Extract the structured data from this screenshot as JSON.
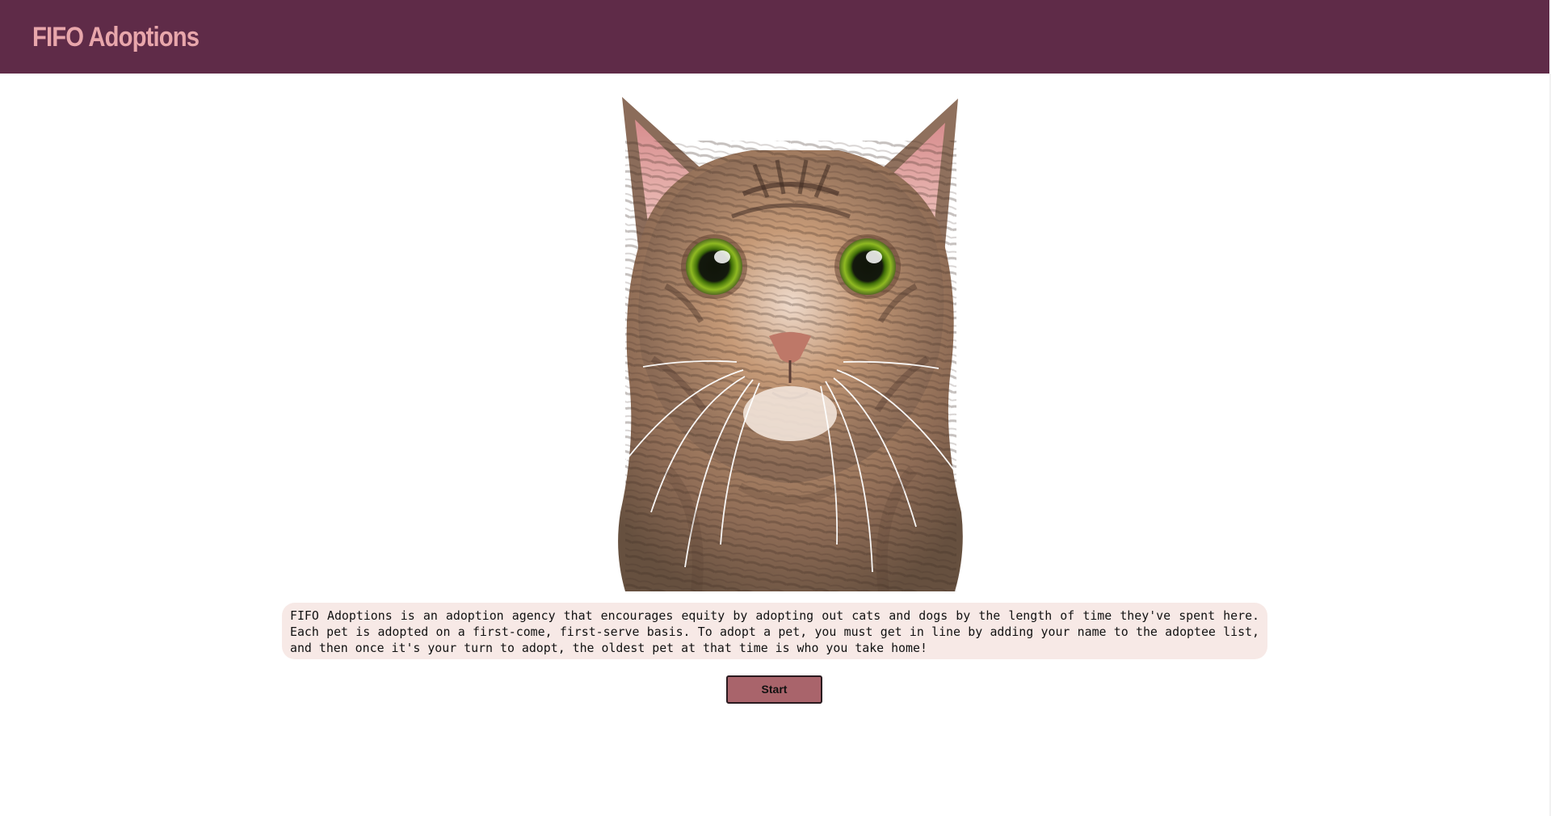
{
  "header": {
    "brand_title": "FIFO Adoptions"
  },
  "hero": {
    "image_icon": "cat-photo",
    "alt": "Tabby cat"
  },
  "intro": {
    "text": "FIFO Adoptions is an adoption agency that encourages equity by adopting out cats and dogs by the length of time they've spent here. Each pet is adopted on a first-come, first-serve basis. To adopt a pet, you must get in line by adding your name to the adoptee list, and then once it's your turn to adopt, the oldest pet at that time is who you take home!"
  },
  "actions": {
    "start_label": "Start"
  },
  "colors": {
    "header_bg": "#5f2b48",
    "brand_text": "#e8a6ab",
    "description_bg": "#f7e9e6",
    "button_bg": "#a9646b"
  }
}
